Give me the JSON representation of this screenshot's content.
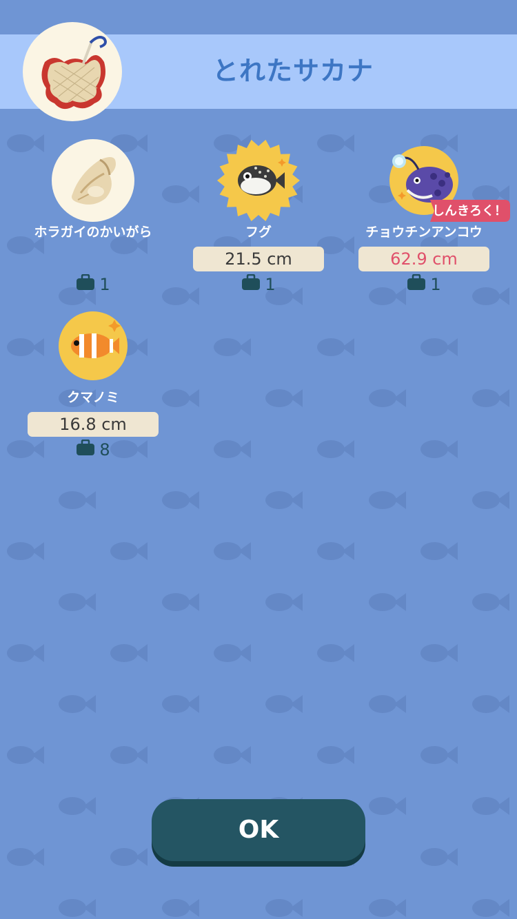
{
  "header": {
    "title": "とれたサカナ",
    "icon": "fishing-net-icon"
  },
  "items": [
    {
      "name": "ホラガイのかいがら",
      "size": "",
      "count": "1",
      "icon": "conch-shell-icon",
      "badge_style": "circle"
    },
    {
      "name": "フグ",
      "size": "21.5 cm",
      "count": "1",
      "icon": "pufferfish-icon",
      "badge_style": "sunburst"
    },
    {
      "name": "チョウチンアンコウ",
      "size": "62.9 cm",
      "count": "1",
      "icon": "anglerfish-icon",
      "badge_style": "sunburst",
      "record": "しんきろく！"
    },
    {
      "name": "クマノミ",
      "size": "16.8 cm",
      "count": "8",
      "icon": "clownfish-icon",
      "badge_style": "sunburst"
    }
  ],
  "ok_button": {
    "label": "OK"
  },
  "colors": {
    "background": "#6f95d4",
    "header_band": "#a8c8fb",
    "title": "#3d76c4",
    "size_pill": "#efe6d2",
    "record": "#e0506a",
    "button": "#245563",
    "badge_gold": "#f5c84a"
  }
}
